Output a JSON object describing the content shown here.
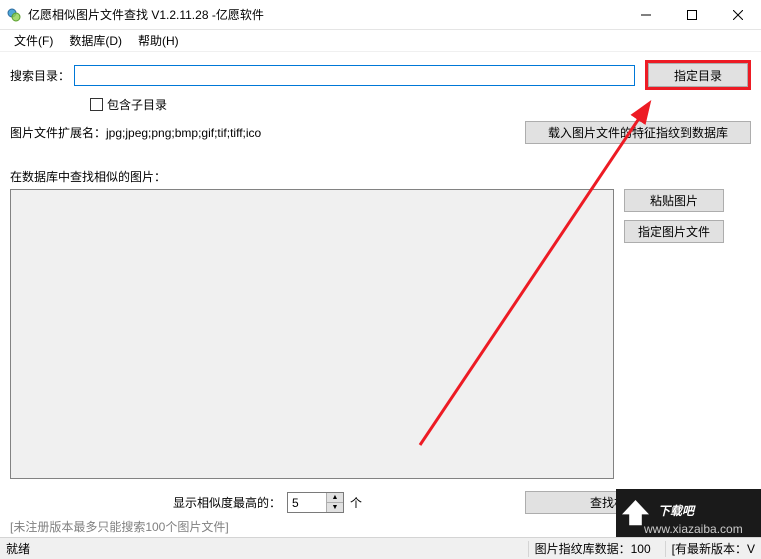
{
  "window": {
    "title": "亿愿相似图片文件查找 V1.2.11.28 -亿愿软件"
  },
  "menu": {
    "file": "文件(F)",
    "database": "数据库(D)",
    "help": "帮助(H)"
  },
  "search": {
    "label": "搜索目录：",
    "value": "",
    "browse_btn": "指定目录",
    "include_sub": "包含子目录"
  },
  "ext": {
    "label": "图片文件扩展名：",
    "value": "jpg;jpeg;png;bmp;gif;tif;tiff;ico",
    "load_btn": "载入图片文件的特征指纹到数据库"
  },
  "similar": {
    "section_label": "在数据库中查找相似的图片：",
    "paste_btn": "粘贴图片",
    "specify_btn": "指定图片文件"
  },
  "results": {
    "show_top_label": "显示相似度最高的：",
    "count": "5",
    "unit": "个",
    "search_btn": "查找相似图片文件",
    "note": "[未注册版本最多只能搜索100个图片文件]"
  },
  "status": {
    "ready": "就绪",
    "db_count_label": "图片指纹库数据：",
    "db_count": "100",
    "version_label": "[有最新版本：V"
  },
  "watermark": {
    "line1": "下载吧",
    "line2": "www.xiazaiba.com"
  }
}
